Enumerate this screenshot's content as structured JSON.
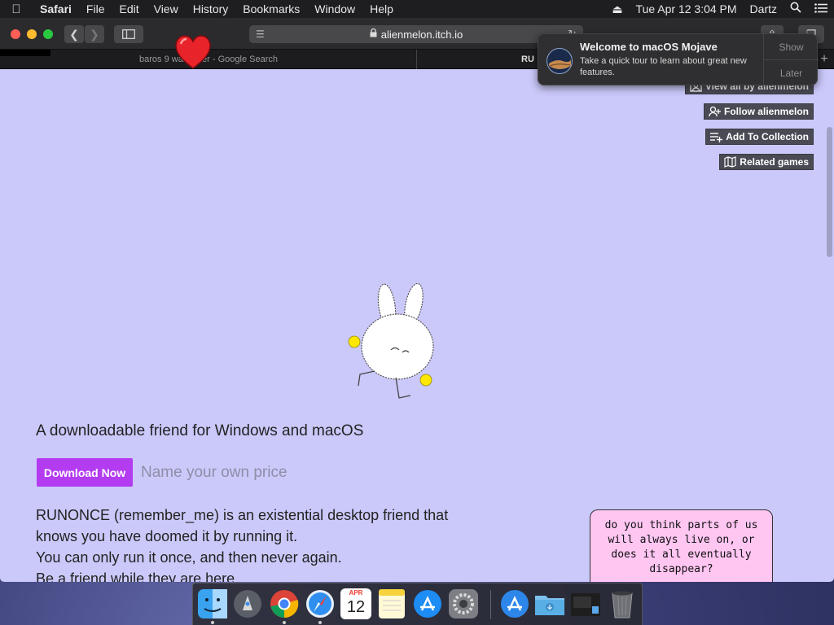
{
  "menubar": {
    "app_name": "Safari",
    "items": [
      "File",
      "Edit",
      "View",
      "History",
      "Bookmarks",
      "Window",
      "Help"
    ],
    "clock": "Tue Apr 12  3:04 PM",
    "user": "Dartz"
  },
  "browser": {
    "url": "alienmelon.itch.io",
    "tabs": [
      {
        "label": "baros 9 wallpaper - Google Search"
      },
      {
        "label": "RU"
      }
    ]
  },
  "notification": {
    "title": "Welcome to macOS Mojave",
    "body": "Take a quick tour to learn about great new features.",
    "show_label": "Show",
    "later_label": "Later"
  },
  "page": {
    "sidebar_buttons": [
      {
        "label": "View all by alienmelon",
        "icon": "user-icon"
      },
      {
        "label": "Follow alienmelon",
        "icon": "user-plus-icon"
      },
      {
        "label": "Add To Collection",
        "icon": "playlist-add-icon"
      },
      {
        "label": "Related games",
        "icon": "map-icon"
      }
    ],
    "tagline": "A downloadable friend for Windows and macOS",
    "download_label": "Download Now",
    "price_text": "Name your own price",
    "description": [
      "RUNONCE (remember_me) is an existential desktop friend that",
      "knows you have doomed it by running it.",
      "You can only run it once, and then never again.",
      "Be a friend while they are here."
    ],
    "speech_bubble": "do you think parts of us will always live on, or does it all eventually disappear?"
  },
  "dock": {
    "apps": [
      "finder-icon",
      "launchpad-icon",
      "chrome-icon",
      "safari-icon",
      "calendar-icon",
      "notes-icon",
      "app-store-icon",
      "system-preferences-icon",
      "downloads-icon",
      "folder-icon",
      "screenshot-icon",
      "trash-icon"
    ],
    "calendar": {
      "month": "APR",
      "day": "12"
    }
  },
  "colors": {
    "page_background": "#cbc9fa",
    "download_button": "#b43cf0",
    "speech_bubble": "#ffc6f2"
  }
}
